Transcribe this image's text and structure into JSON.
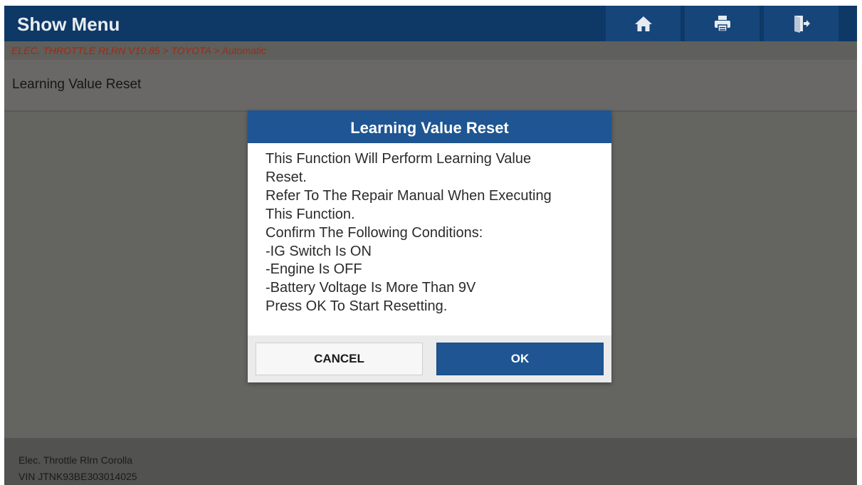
{
  "header": {
    "title": "Show Menu",
    "buttons": [
      {
        "icon": "home-icon"
      },
      {
        "icon": "print-icon"
      },
      {
        "icon": "exit-icon"
      }
    ]
  },
  "breadcrumb": "ELEC. THROTTLE RLRN V10.85 > TOYOTA > Automatic",
  "list": {
    "items": [
      {
        "label": "Learning Value Reset"
      }
    ]
  },
  "dialog": {
    "title": "Learning Value Reset",
    "body_lines": [
      "This Function Will Perform Learning Value",
      "Reset.",
      "Refer To The Repair Manual When Executing",
      "This Function.",
      "Confirm The Following Conditions:",
      "-IG Switch Is ON",
      "-Engine Is OFF",
      "-Battery Voltage Is More Than 9V",
      "Press OK To Start Resetting."
    ],
    "cancel_label": "CANCEL",
    "ok_label": "OK"
  },
  "footer": {
    "line1": "Elec. Throttle Rlrn Corolla",
    "line2": "VIN JTNK93BE303014025"
  },
  "colors": {
    "header_bg": "#0e3866",
    "accent": "#1e5592",
    "breadcrumb_text": "#a02a14",
    "overlay_bg": "#646461"
  }
}
